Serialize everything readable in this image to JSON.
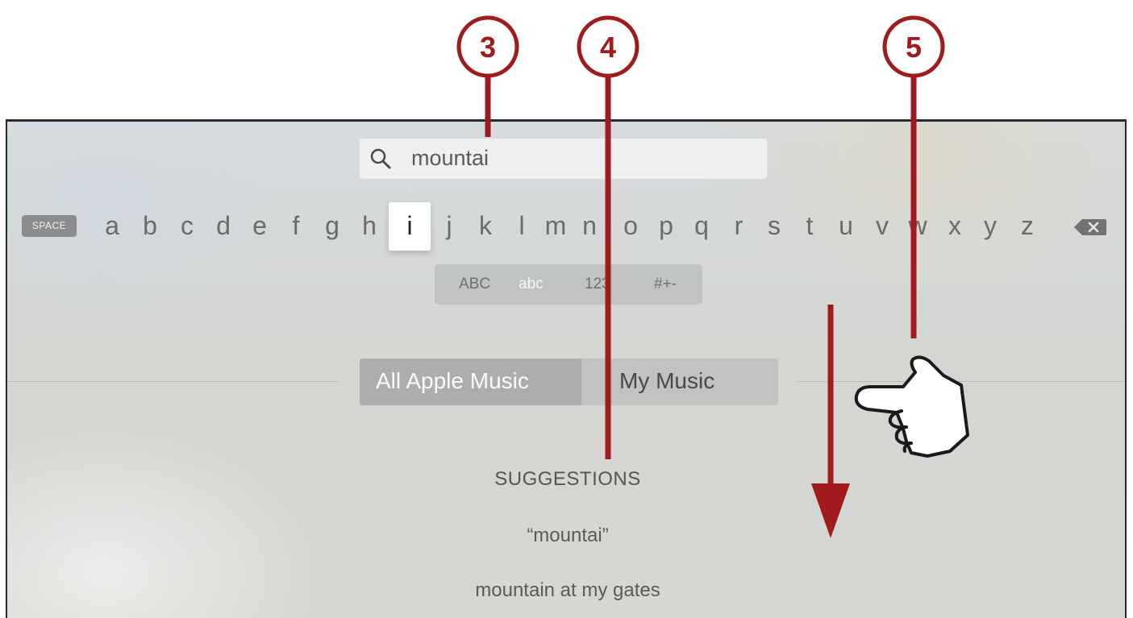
{
  "search": {
    "query": "mountai"
  },
  "keyboard": {
    "space_label": "SPACE",
    "letters": [
      "a",
      "b",
      "c",
      "d",
      "e",
      "f",
      "g",
      "h",
      "i",
      "j",
      "k",
      "l",
      "m",
      "n",
      "o",
      "p",
      "q",
      "r",
      "s",
      "t",
      "u",
      "v",
      "w",
      "x",
      "y",
      "z"
    ],
    "focused_letter": "i",
    "modes": [
      "ABC",
      "abc",
      "123",
      "#+-"
    ],
    "active_mode": "abc"
  },
  "scope": {
    "options": [
      "All Apple Music",
      "My Music"
    ],
    "selected": "All Apple Music"
  },
  "suggestions": {
    "heading": "SUGGESTIONS",
    "items": [
      "“mountai”",
      "mountain at my gates"
    ]
  },
  "callouts": [
    "3",
    "4",
    "5"
  ],
  "colors": {
    "callout_red": "#a11b1e",
    "focused_key_bg": "#ffffff"
  },
  "icons": {
    "search": "search-icon",
    "backspace": "backspace-icon",
    "gesture": "swipe-hand-icon",
    "arrow": "arrow-down-icon"
  }
}
